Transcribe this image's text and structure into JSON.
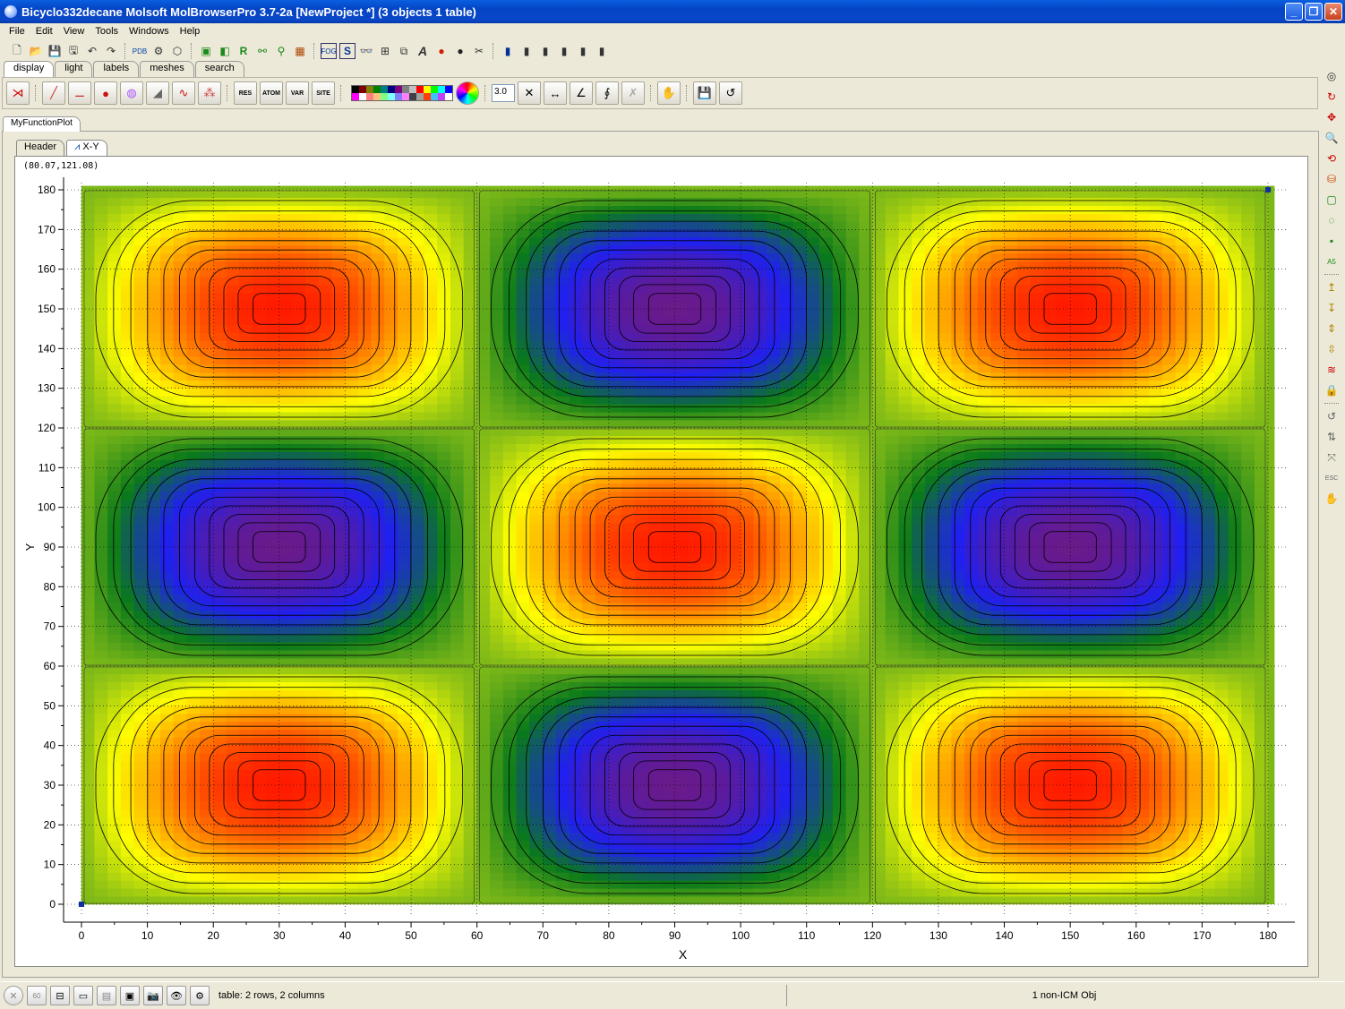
{
  "window": {
    "title": "Bicyclo332decane Molsoft MolBrowserPro 3.7-2a  [NewProject *] (3 objects 1 table)"
  },
  "menu": [
    "File",
    "Edit",
    "View",
    "Tools",
    "Windows",
    "Help"
  ],
  "display_tabs": [
    "display",
    "light",
    "labels",
    "meshes",
    "search"
  ],
  "toolbar2": {
    "number_field": "3.0"
  },
  "doc_tab": "MyFunctionPlot",
  "sub_tabs": [
    "Header",
    "X-Y"
  ],
  "plot": {
    "cursor_coords": "(80.07,121.08)"
  },
  "chart_data": {
    "type": "heatmap",
    "function_form": "sin(6*x deg) * sin(6*y deg) style checker of 3x3 cells",
    "xlabel": "X",
    "ylabel": "Y",
    "xlim": [
      0,
      180
    ],
    "ylim": [
      0,
      180
    ],
    "x_ticks": [
      0,
      10,
      20,
      30,
      40,
      50,
      60,
      70,
      80,
      90,
      100,
      110,
      120,
      130,
      140,
      150,
      160,
      170,
      180
    ],
    "y_ticks": [
      0,
      10,
      20,
      30,
      40,
      50,
      60,
      70,
      80,
      90,
      100,
      110,
      120,
      130,
      140,
      150,
      160,
      170,
      180
    ],
    "cells": [
      {
        "x_center": 30,
        "y_center": 150,
        "sign": "max"
      },
      {
        "x_center": 90,
        "y_center": 150,
        "sign": "min"
      },
      {
        "x_center": 150,
        "y_center": 150,
        "sign": "max"
      },
      {
        "x_center": 30,
        "y_center": 90,
        "sign": "min"
      },
      {
        "x_center": 90,
        "y_center": 90,
        "sign": "max"
      },
      {
        "x_center": 150,
        "y_center": 90,
        "sign": "min"
      },
      {
        "x_center": 30,
        "y_center": 30,
        "sign": "max"
      },
      {
        "x_center": 90,
        "y_center": 30,
        "sign": "min"
      },
      {
        "x_center": 150,
        "y_center": 30,
        "sign": "max"
      }
    ],
    "colormap": [
      "#6a1a8a",
      "#2020f0",
      "#0a7a1a",
      "#7cb818",
      "#ffff00",
      "#ff8c00",
      "#ff1a00"
    ],
    "grid": true
  },
  "status": {
    "table_info": "table: 2 rows, 2 columns",
    "objects": "1 non-ICM Obj"
  }
}
